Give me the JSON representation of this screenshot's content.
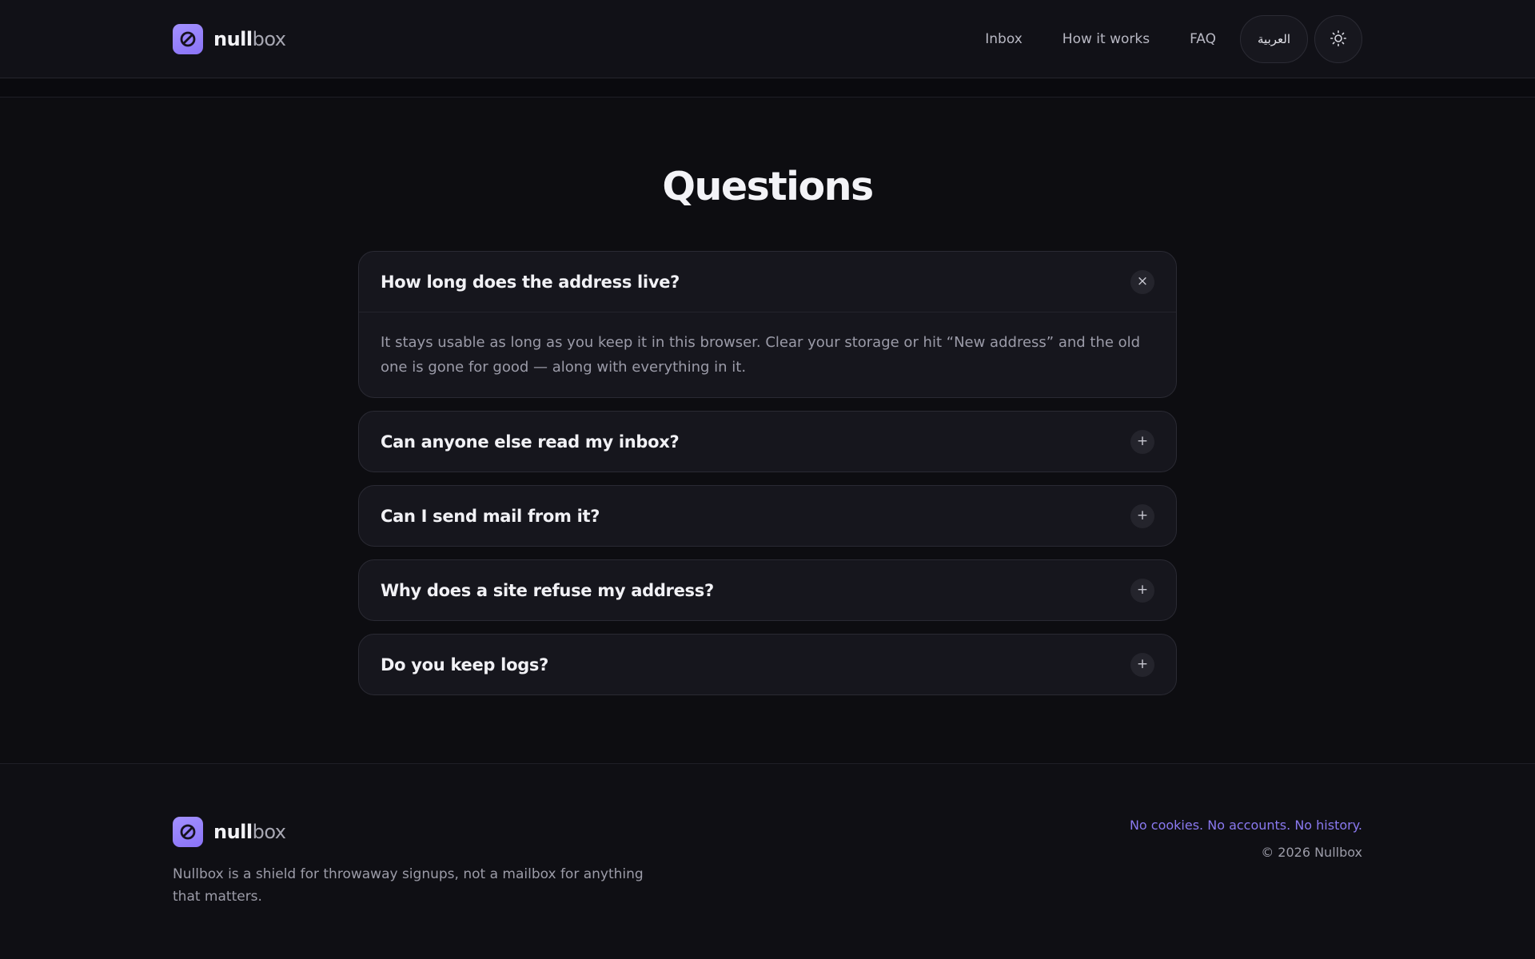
{
  "brand": {
    "name_strong": "null",
    "name_light": "box",
    "logo_icon": "slashed-circle-icon",
    "accent_color": "#8a73f7"
  },
  "nav": {
    "links": [
      "Inbox",
      "How it works",
      "FAQ"
    ],
    "language_label": "العربية",
    "theme_icon": "sun-icon"
  },
  "faq": {
    "title": "Questions",
    "items": [
      {
        "question": "How long does the address live?",
        "answer": "It stays usable as long as you keep it in this browser. Clear your storage or hit “New address” and the old one is gone for good — along with everything in it.",
        "expanded": true,
        "toggle": "×"
      },
      {
        "question": "Can anyone else read my inbox?",
        "expanded": false,
        "toggle": "+"
      },
      {
        "question": "Can I send mail from it?",
        "expanded": false,
        "toggle": "+"
      },
      {
        "question": "Why does a site refuse my address?",
        "expanded": false,
        "toggle": "+"
      },
      {
        "question": "Do you keep logs?",
        "expanded": false,
        "toggle": "+"
      }
    ]
  },
  "footer": {
    "description": "Nullbox is a shield for throwaway signups, not a mailbox for anything that matters.",
    "tagline": "No cookies. No accounts. No history.",
    "copyright": "© 2026 Nullbox"
  }
}
